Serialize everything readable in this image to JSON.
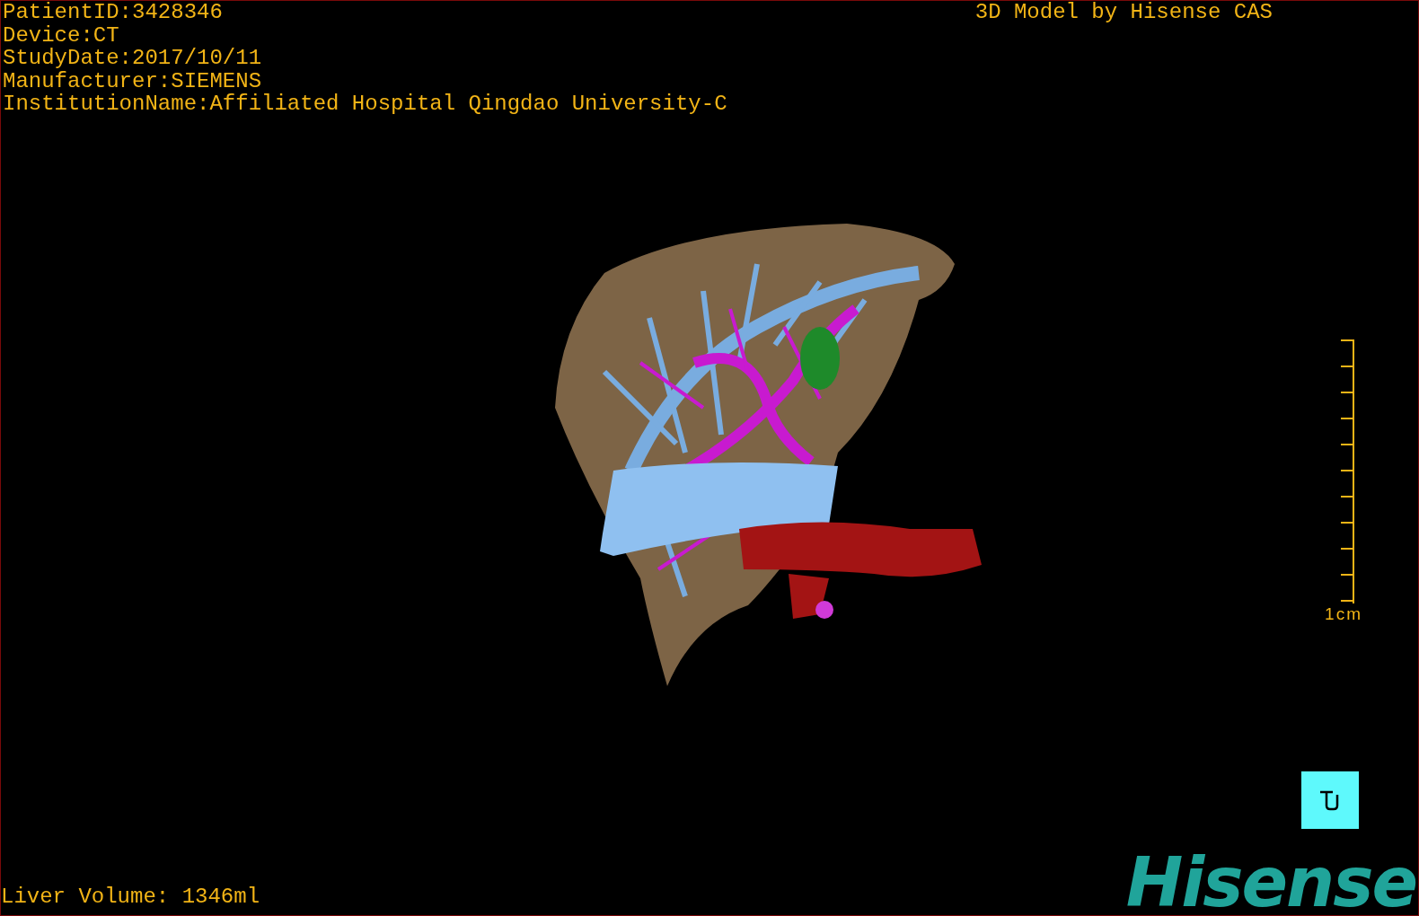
{
  "info_lines": [
    "PatientID:3428346",
    "Device:CT",
    "StudyDate:2017/10/11",
    "Manufacturer:SIEMENS",
    "InstitutionName:Affiliated Hospital Qingdao University-C"
  ],
  "brand": "3D Model by Hisense CAS",
  "scale": {
    "label": "1cm"
  },
  "liver_volume": "Liver Volume: 1346ml",
  "logo": "Hisense"
}
